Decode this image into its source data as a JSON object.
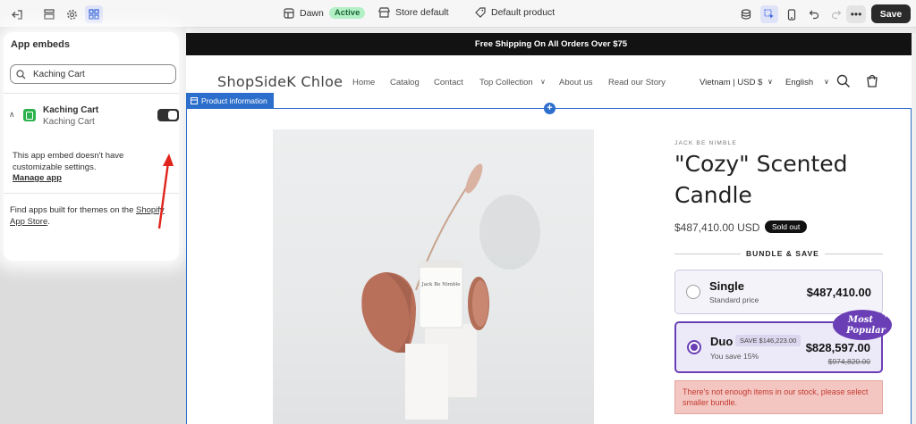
{
  "topbar": {
    "theme_name": "Dawn",
    "theme_status": "Active",
    "store_label": "Store default",
    "product_label": "Default product",
    "more_label": "•••",
    "save_label": "Save"
  },
  "sidebar": {
    "title": "App embeds",
    "search_value": "Kaching Cart",
    "app": {
      "name": "Kaching Cart",
      "subtitle": "Kaching Cart",
      "enabled": true
    },
    "embed_note": "This app embed doesn't have customizable settings.",
    "manage_link": "Manage app",
    "find_apps_text": "Find apps built for themes on the ",
    "find_apps_link": "Shopify App Store",
    "find_apps_end": "."
  },
  "preview": {
    "announcement": "Free Shipping On All Orders Over $75",
    "store_logo": "ShopSideK Chloe",
    "nav": [
      "Home",
      "Catalog",
      "Contact",
      "Top Collection",
      "About us",
      "Read our Story"
    ],
    "locale_country": "Vietnam | USD $",
    "locale_language": "English",
    "section_tag": "Product information",
    "product": {
      "vendor": "JACK BE NIMBLE",
      "title": "\"Cozy\" Scented Candle",
      "price": "$487,410.00 USD",
      "badge": "Sold out",
      "candle_label": "Jack Be Nimble"
    },
    "bundle": {
      "heading": "BUNDLE & SAVE",
      "options": [
        {
          "name": "Single",
          "subtitle": "Standard price",
          "price": "$487,410.00",
          "selected": false
        },
        {
          "name": "Duo",
          "subtitle": "You save 15%",
          "save_pill": "SAVE $146,223.00",
          "price": "$828,597.00",
          "old_price": "$974,820.00",
          "selected": true
        }
      ],
      "popular_badge": [
        "Most",
        "Popular"
      ],
      "stock_error": "There's not enough items in our stock, please select smaller bundle."
    }
  },
  "colors": {
    "accent_blue": "#2c6ecb",
    "bundle_purple": "#6a3fb6",
    "active_badge": "#b4f0c5",
    "error_bg": "#f4c6c2"
  }
}
